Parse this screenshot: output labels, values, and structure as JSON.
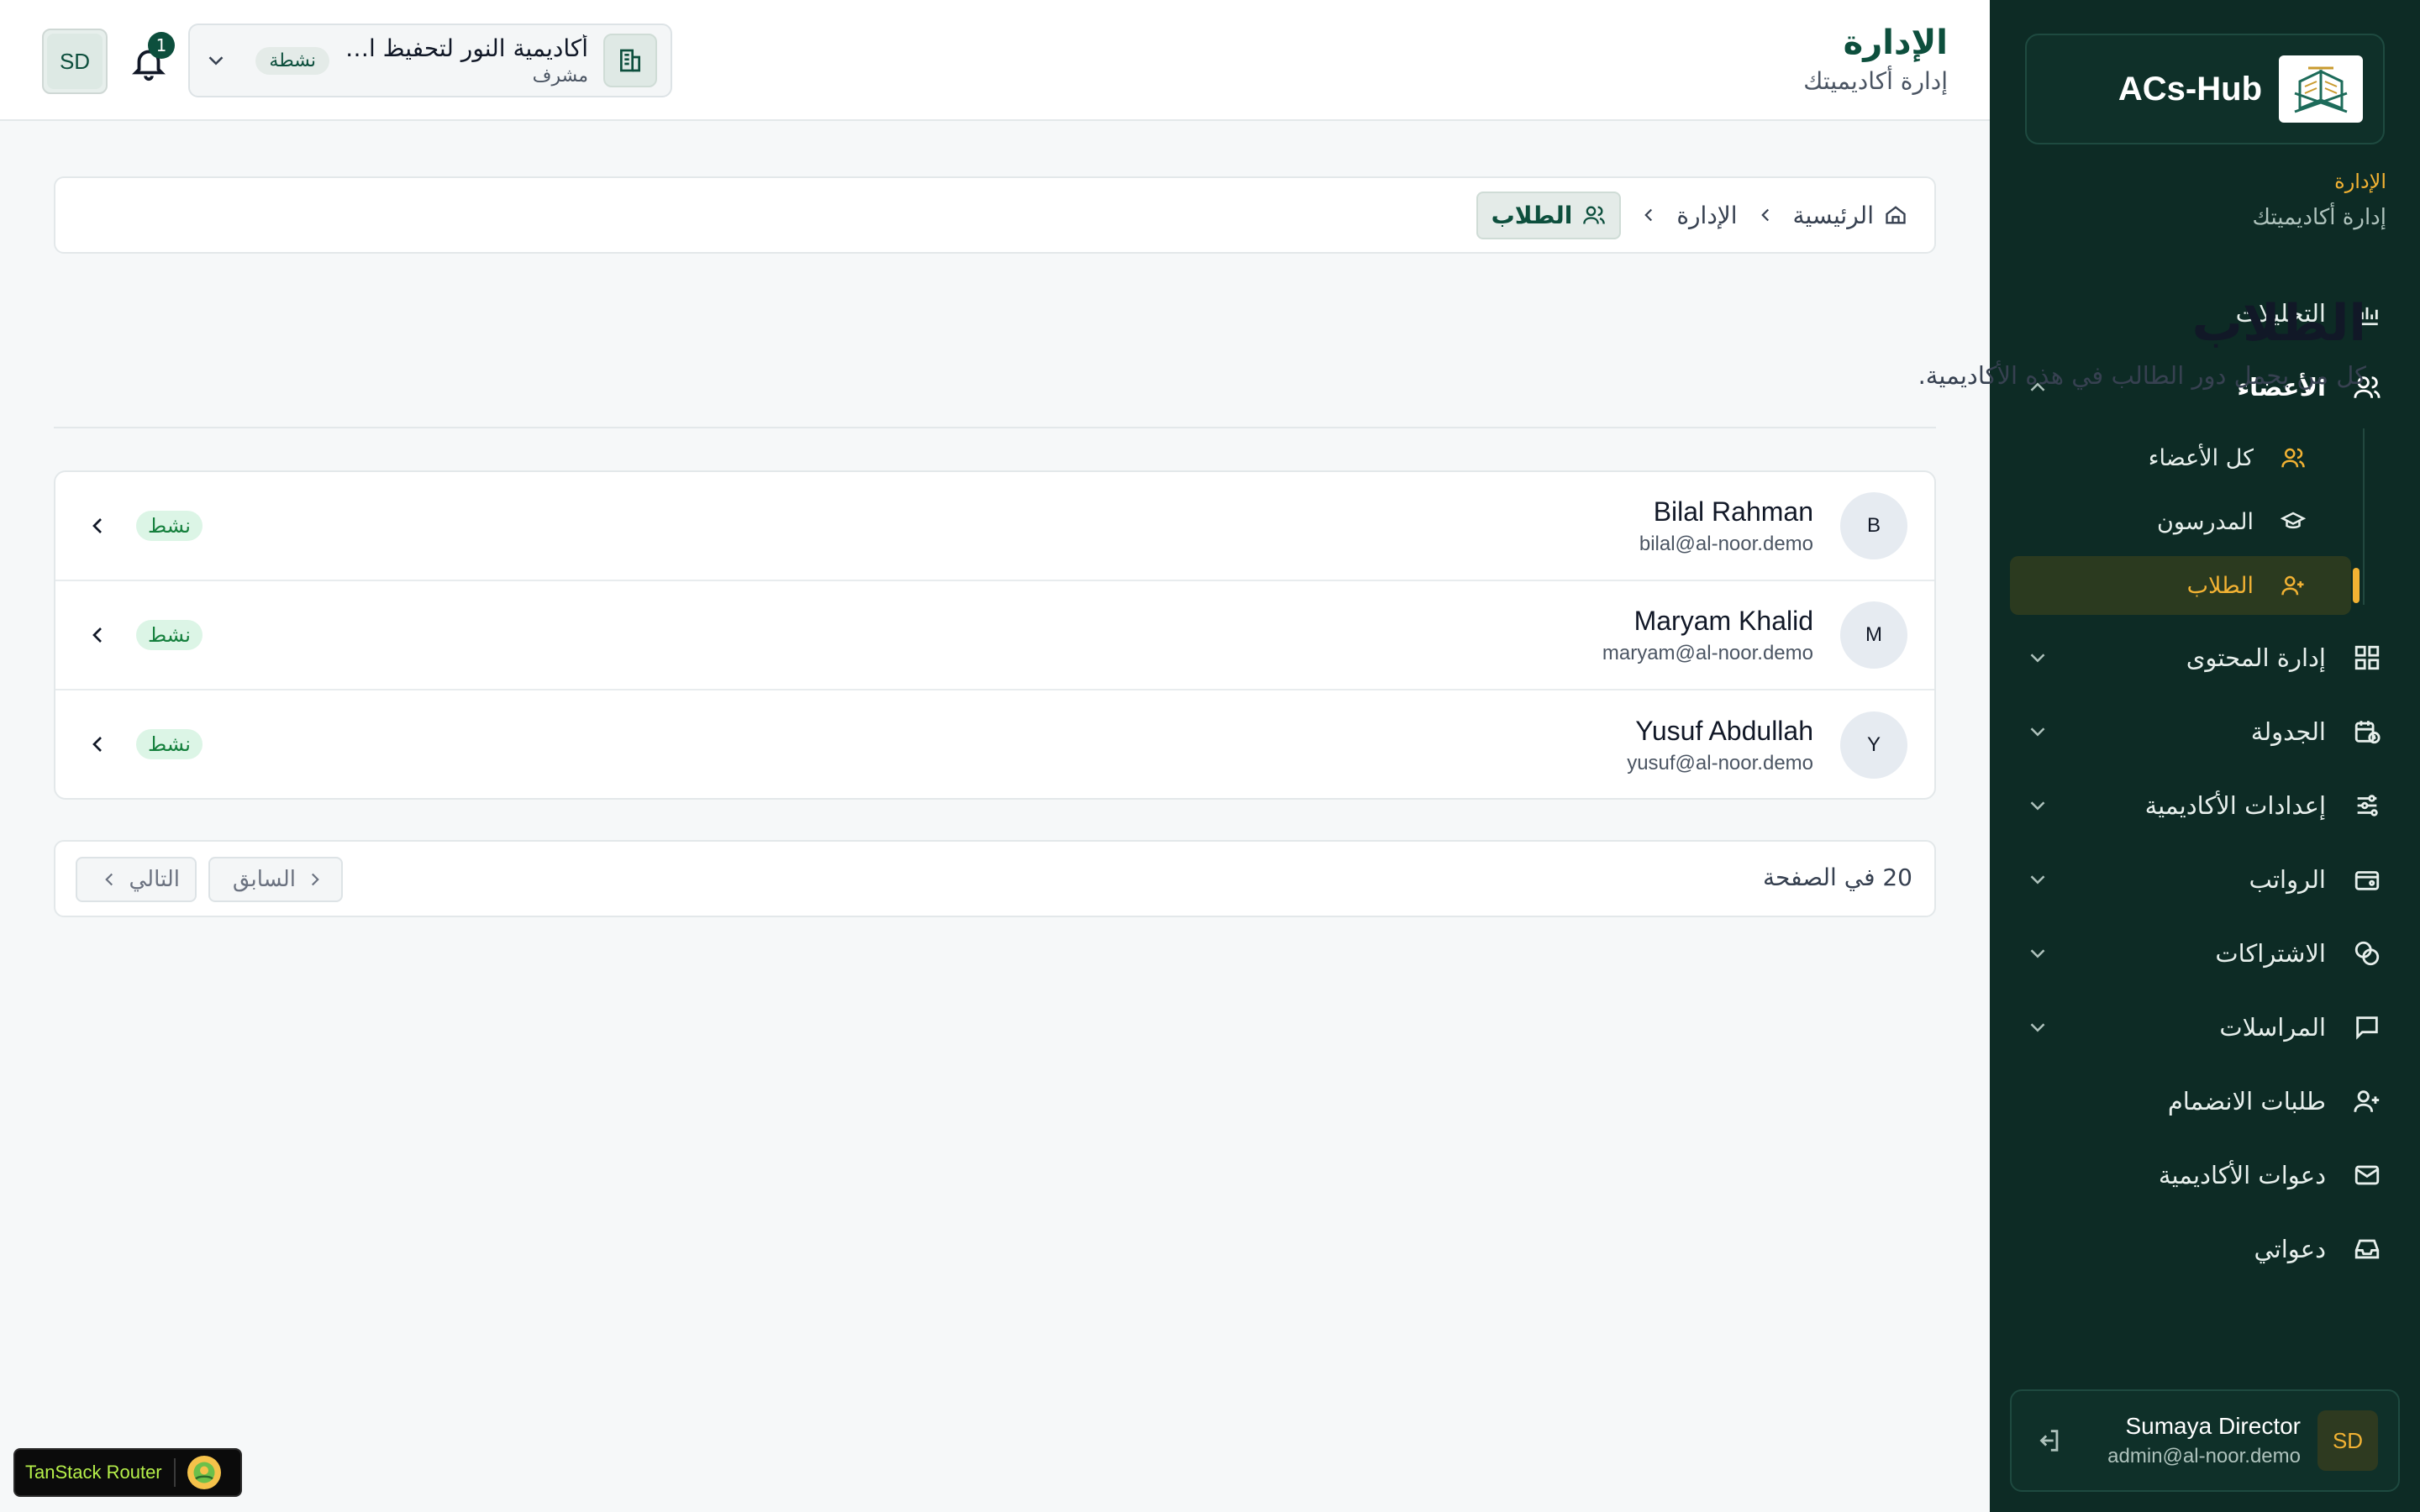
{
  "brand": {
    "name": "ACs-Hub"
  },
  "sidebar": {
    "section_key": "الإدارة",
    "section_value": "إدارة أكاديميتك",
    "nav": {
      "analytics": "التحليلات",
      "members": "الأعضاء",
      "members_sub": {
        "all": "كل الأعضاء",
        "teachers": "المدرسون",
        "students": "الطلاب"
      },
      "content": "إدارة المحتوى",
      "schedule": "الجدولة",
      "academy_settings": "إعدادات الأكاديمية",
      "salaries": "الرواتب",
      "subscriptions": "الاشتراكات",
      "messages": "المراسلات",
      "join_requests": "طلبات الانضمام",
      "academy_invites": "دعوات الأكاديمية",
      "my_invites": "دعواتي"
    },
    "user": {
      "initials": "SD",
      "name": "Sumaya Director",
      "email": "admin@al-noor.demo"
    }
  },
  "header": {
    "title": "الإدارة",
    "subtitle": "إدارة أكاديميتك",
    "avatar_initials": "SD",
    "notifications_count": "1",
    "academy": {
      "name": "أكاديمية النور لتحفيظ القرآن",
      "role": "مشرف",
      "status": "نشطة"
    }
  },
  "breadcrumb": {
    "home": "الرئيسية",
    "admin": "الإدارة",
    "current": "الطلاب"
  },
  "page": {
    "title": "الطلاب",
    "subtitle": "كل من يحمل دور الطالب في هذه الأكاديمية."
  },
  "students": [
    {
      "initial": "B",
      "name": "Bilal Rahman",
      "email": "bilal@al-noor.demo",
      "status": "نشط"
    },
    {
      "initial": "M",
      "name": "Maryam Khalid",
      "email": "maryam@al-noor.demo",
      "status": "نشط"
    },
    {
      "initial": "Y",
      "name": "Yusuf Abdullah",
      "email": "yusuf@al-noor.demo",
      "status": "نشط"
    }
  ],
  "pagination": {
    "per_page": "20 في الصفحة",
    "prev": "السابق",
    "next": "التالي"
  },
  "devtools": {
    "label": "TanStack Router"
  },
  "colors": {
    "sidebar_bg": "#0d2b25",
    "accent_gold": "#f2b233",
    "brand_green": "#0d4f3d",
    "status_green": "#15803d"
  },
  "icons": {
    "analytics": "bar-chart-icon",
    "members": "users-icon",
    "teachers": "graduation-cap-icon",
    "students": "user-plus-icon",
    "content": "grid-icon",
    "schedule": "calendar-clock-icon",
    "settings": "sliders-icon",
    "salaries": "wallet-icon",
    "subscriptions": "coins-icon",
    "messages": "message-square-icon",
    "join_requests": "user-plus-icon",
    "academy_invites": "mail-icon",
    "my_invites": "inbox-icon"
  }
}
